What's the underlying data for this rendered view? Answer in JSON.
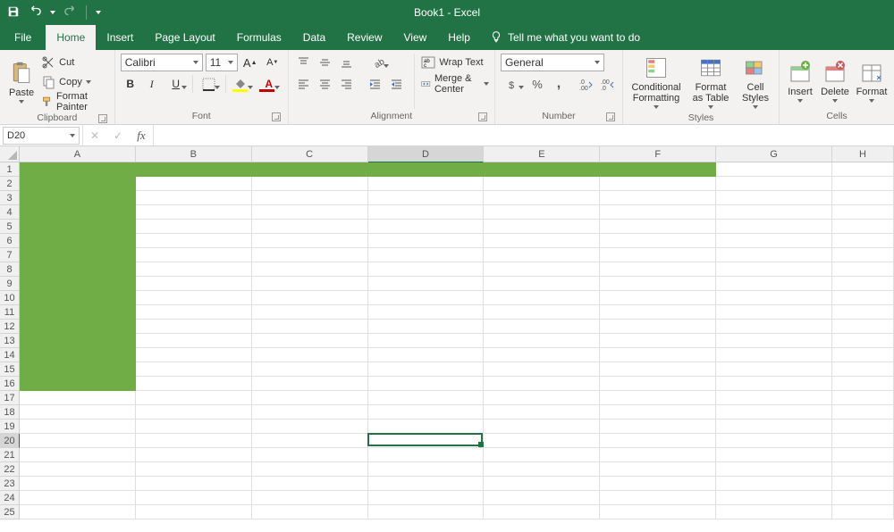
{
  "title": "Book1  -  Excel",
  "qat": {
    "save": "Save",
    "undo": "Undo",
    "redo": "Redo"
  },
  "tabs": {
    "file": "File",
    "home": "Home",
    "insert": "Insert",
    "pagelayout": "Page Layout",
    "formulas": "Formulas",
    "data": "Data",
    "review": "Review",
    "view": "View",
    "help": "Help",
    "tellme": "Tell me what you want to do"
  },
  "ribbon": {
    "clipboard": {
      "label": "Clipboard",
      "paste": "Paste",
      "cut": "Cut",
      "copy": "Copy",
      "fmtpainter": "Format Painter"
    },
    "font": {
      "label": "Font",
      "name": "Calibri",
      "size": "11",
      "bold": "B",
      "italic": "I",
      "underline": "U"
    },
    "alignment": {
      "label": "Alignment",
      "wrap": "Wrap Text",
      "merge": "Merge & Center"
    },
    "number": {
      "label": "Number",
      "format": "General"
    },
    "styles": {
      "label": "Styles",
      "cond": "Conditional Formatting",
      "table": "Format as Table",
      "cell": "Cell Styles"
    },
    "cells": {
      "label": "Cells",
      "insert": "Insert",
      "delete": "Delete",
      "format": "Format"
    }
  },
  "namebox": "D20",
  "formula": "",
  "columns": [
    "A",
    "B",
    "C",
    "D",
    "E",
    "F",
    "G",
    "H"
  ],
  "activeCell": {
    "col": "D",
    "row": 20
  },
  "greenFill": {
    "row1Cols": [
      "A",
      "B",
      "C",
      "D",
      "E",
      "F"
    ],
    "colAEndRow": 16
  },
  "rowCount": 25
}
